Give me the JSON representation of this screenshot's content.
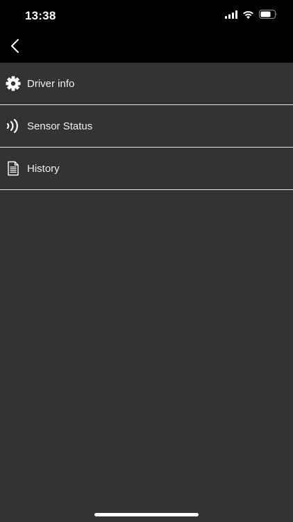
{
  "status_bar": {
    "time": "13:38",
    "icons": [
      "cellular-signal-icon",
      "wifi-icon",
      "battery-icon"
    ]
  },
  "nav": {
    "back_icon": "chevron-left-icon"
  },
  "menu": {
    "items": [
      {
        "label": "Driver info",
        "icon": "gear-icon"
      },
      {
        "label": "Sensor Status",
        "icon": "signal-waves-icon"
      },
      {
        "label": "History",
        "icon": "document-icon"
      }
    ]
  },
  "colors": {
    "background": "#333333",
    "bar_background": "#000000",
    "text": "#ffffff",
    "divider": "#e6e6e6"
  }
}
